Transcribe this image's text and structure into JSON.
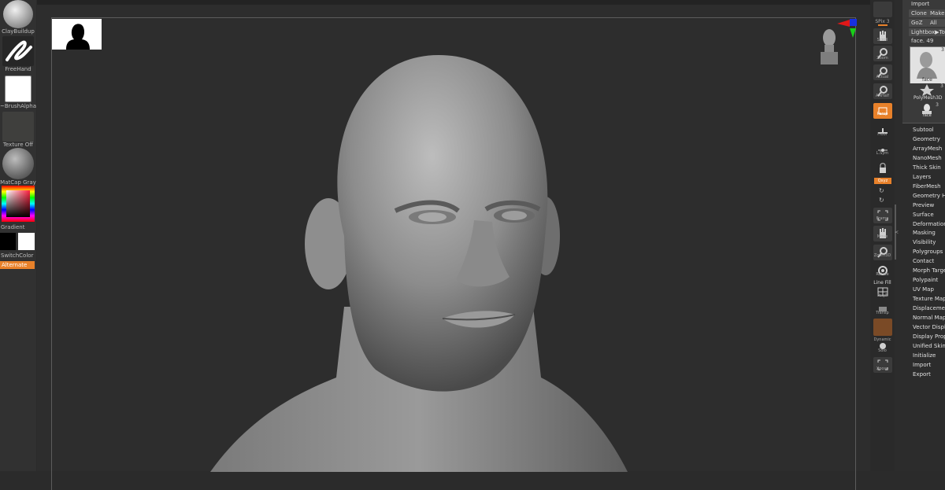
{
  "left_shelf": {
    "brush_label": "ClayBuildup",
    "stroke_label": "FreeHand",
    "alpha_label": "~BrushAlpha",
    "texture_label": "Texture Off",
    "material_label": "MatCap Gray",
    "gradient_label": "Gradient",
    "switchcolor_label": "SwitchColor",
    "alternate_label": "Alternate"
  },
  "right_shelf": {
    "spix_label": "SPix",
    "spix_value": "3",
    "buttons": [
      "Scroll",
      "Zoom",
      "Actual",
      "AAHalf",
      "Persp",
      "Floor",
      "L.Sym",
      "",
      "Qxyz",
      "",
      "",
      "Frame",
      "Move",
      "Zoom3D",
      "Rotate",
      "Line Fill",
      "PolyF",
      "Transp",
      "",
      "Dynamic",
      "Solo",
      "Xpose"
    ]
  },
  "tool_panel": {
    "import_label": "Import",
    "clone_label": "Clone",
    "make_label": "Make F",
    "goz_label": "GoZ",
    "all_label": "All",
    "lightbox_label": "Lightbox▶Tools",
    "face_label": "face. 49",
    "thumb_face_label": "face",
    "thumb_face_count": "3",
    "thumb_poly_label": "PolyMesh3D",
    "thumb_poly_count": "3",
    "thumb_small_label": "face",
    "thumb_small_count": "3",
    "menu": [
      "Subtool",
      "Geometry",
      "ArrayMesh",
      "NanoMesh",
      "Thick Skin",
      "Layers",
      "FiberMesh",
      "Geometry HD",
      "Preview",
      "Surface",
      "Deformation",
      "Masking",
      "Visibility",
      "Polygroups",
      "Contact",
      "Morph Target",
      "Polypaint",
      "UV Map",
      "Texture Map",
      "Displacement Map",
      "Normal Map",
      "Vector Displacement",
      "Display Properties",
      "Unified Skin",
      "Initialize",
      "Import",
      "Export"
    ]
  },
  "colors": {
    "accent_orange": "#e8812a",
    "primary_color": "#000000",
    "secondary_color": "#ffffff"
  }
}
